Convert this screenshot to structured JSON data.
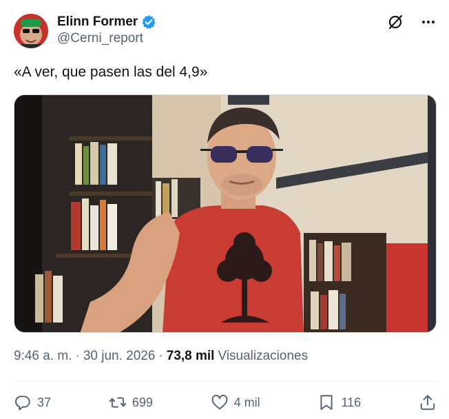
{
  "author": {
    "name": "Elinn Former",
    "handle": "@Cerni_report",
    "verified": true
  },
  "tweet": {
    "text": "«A ver, que pasen las del 4,9»"
  },
  "meta": {
    "time": "9:46 a. m.",
    "separator": "·",
    "date": "30 jun. 2026",
    "views_count": "73,8 mil",
    "views_label": "Visualizaciones"
  },
  "actions": {
    "replies": "37",
    "reposts": "699",
    "likes": "4 mil",
    "bookmarks": "116"
  },
  "icons": {
    "verified": "verified-badge-icon",
    "grok": "grok-icon",
    "more": "more-icon",
    "reply": "reply-icon",
    "repost": "repost-icon",
    "like": "heart-icon",
    "bookmark": "bookmark-icon",
    "share": "share-icon"
  },
  "colors": {
    "accent": "#1d9bf0",
    "text": "#0f1419",
    "muted": "#536471",
    "border": "#eff3f4"
  }
}
